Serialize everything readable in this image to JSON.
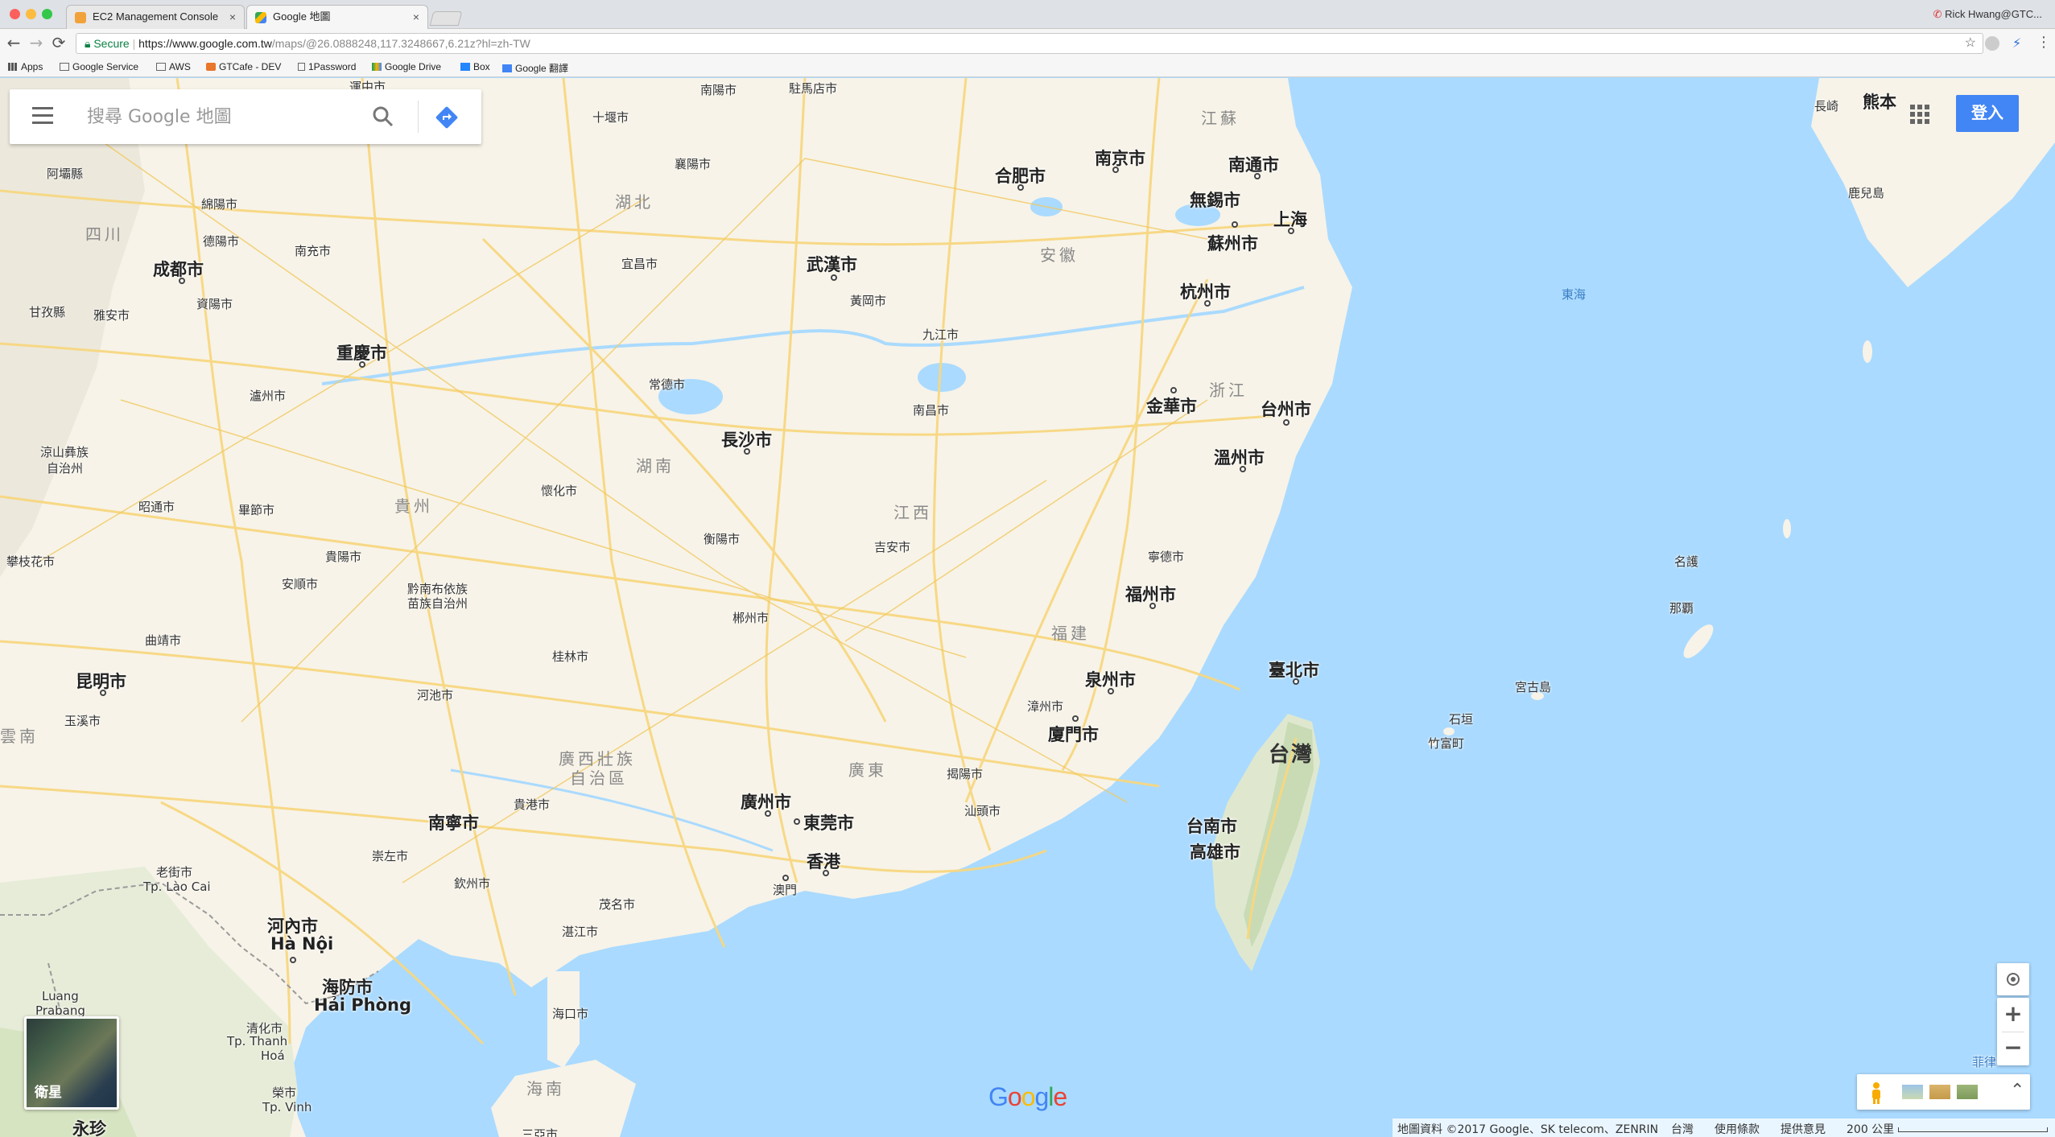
{
  "browser": {
    "tabs": [
      {
        "title": "EC2 Management Console",
        "close": "×"
      },
      {
        "title": "Google 地圖",
        "close": "×"
      }
    ],
    "user": "Rick Hwang@GTC...",
    "nav": {
      "back": "←",
      "forward": "→",
      "reload": "⟳"
    },
    "omnibox": {
      "secure": "Secure",
      "host": "https://www.google.com.tw",
      "path": "/maps/@26.0888248,117.3248667,6.21z?hl=zh-TW",
      "star": "☆"
    },
    "bookmarks": [
      "Apps",
      "Google Service",
      "AWS",
      "GTCafe - DEV",
      "1Password",
      "Google Drive",
      "Box",
      "Google 翻譯"
    ]
  },
  "map": {
    "search_placeholder": "搜尋 Google 地圖",
    "signin": "登入",
    "satellite": "衛星",
    "zoom_in": "+",
    "zoom_out": "−",
    "logo": "Google",
    "footer": {
      "data": "地圖資料 ©2017 Google、SK telecom、ZENRIN",
      "region": "台灣",
      "terms": "使用條款",
      "feedback": "提供意見",
      "scale": "200 公里"
    },
    "labels": {
      "jiangsu": "江蘇",
      "hubei": "湖北",
      "sichuan": "四川",
      "anhui": "安徽",
      "zhejiang": "浙江",
      "hunan": "湖南",
      "guizhou": "貴州",
      "jiangxi": "江西",
      "fujian": "福建",
      "guangxi1": "廣西壯族",
      "guangxi2": "自治區",
      "guangdong": "廣東",
      "yunnan": "雲南",
      "hainan": "海南",
      "east_sea": "東海",
      "taiwan": "台灣",
      "nanyang": "南陽市",
      "zhumadian": "駐馬店市",
      "xuzhou_top": "運中市",
      "shiyan": "十堰市",
      "xiangyang": "襄陽市",
      "hefei": "合肥市",
      "nanjing": "南京市",
      "nantong": "南通市",
      "wuxi": "無錫市",
      "suzhou": "蘇州市",
      "shanghai": "上海",
      "mianyang": "綿陽市",
      "deyang": "德陽市",
      "nanchong": "南充市",
      "yichang": "宜昌市",
      "wuhan": "武漢市",
      "huanggang": "黃岡市",
      "hangzhou": "杭州市",
      "chengdu": "成都市",
      "ziyang": "資陽市",
      "aba": "阿壩縣",
      "ganzi": "甘孜縣",
      "yaan": "雅安市",
      "jiujiang": "九江市",
      "chongqing": "重慶市",
      "changde": "常德市",
      "jinhua": "金華市",
      "luzhou": "瀘州市",
      "nanchang": "南昌市",
      "taizhou": "台州市",
      "changsha": "長沙市",
      "wenzhou": "溫州市",
      "liangshan1": "涼山彝族",
      "liangshan2": "自治州",
      "huaihua": "懷化市",
      "zhaotong": "昭通市",
      "bijie": "畢節市",
      "hengyang": "衡陽市",
      "jian": "吉安市",
      "ningde": "寧德市",
      "panzhihua": "攀枝花市",
      "guiyang": "貴陽市",
      "anshun": "安順市",
      "qiannan1": "黔南布依族",
      "qiannan2": "苗族自治州",
      "fuzhou": "福州市",
      "chenzhou": "郴州市",
      "naha": "那覇",
      "nago": "名護",
      "qujing": "曲靖市",
      "guilin": "桂林市",
      "taipei": "臺北市",
      "kunming": "昆明市",
      "quanzhou": "泉州市",
      "miyakojima": "宮古島",
      "yuxi": "玉溪市",
      "hechi": "河池市",
      "zhangzhou": "漳州市",
      "xiamen": "廈門市",
      "ishigaki": "石垣",
      "taketomi": "竹富町",
      "jieyang": "揭陽市",
      "shantou": "汕頭市",
      "guangzhou": "廣州市",
      "dongguan": "東莞市",
      "hongkong": "香港",
      "guigang": "貴港市",
      "nanning": "南寧市",
      "tainan": "台南市",
      "kaohsiung": "高雄市",
      "chongzuo": "崇左市",
      "qinzhou": "欽州市",
      "macau": "澳門",
      "maoming": "茂名市",
      "laocai1": "老街市",
      "laocai2": "Tp. Lào Cai",
      "hanoi1": "河內市",
      "hanoi2": "Hà Nội",
      "zhanjiang": "湛江市",
      "haiphong1": "海防市",
      "haiphong2": "Hải Phòng",
      "luang1": "Luang",
      "luang2": "Prabang",
      "haikou": "海口市",
      "thanhhoa1": "清化市",
      "thanhhoa2": "Tp. Thanh",
      "thanhhoa3": "Hoá",
      "vinh1": "榮市",
      "vinh2": "Tp. Vinh",
      "vientiane": "永珍",
      "sanya": "三亞市",
      "nagasaki": "長崎",
      "kumamoto": "熊本",
      "kagoshima": "鹿兒島",
      "philippines": "菲律"
    }
  }
}
